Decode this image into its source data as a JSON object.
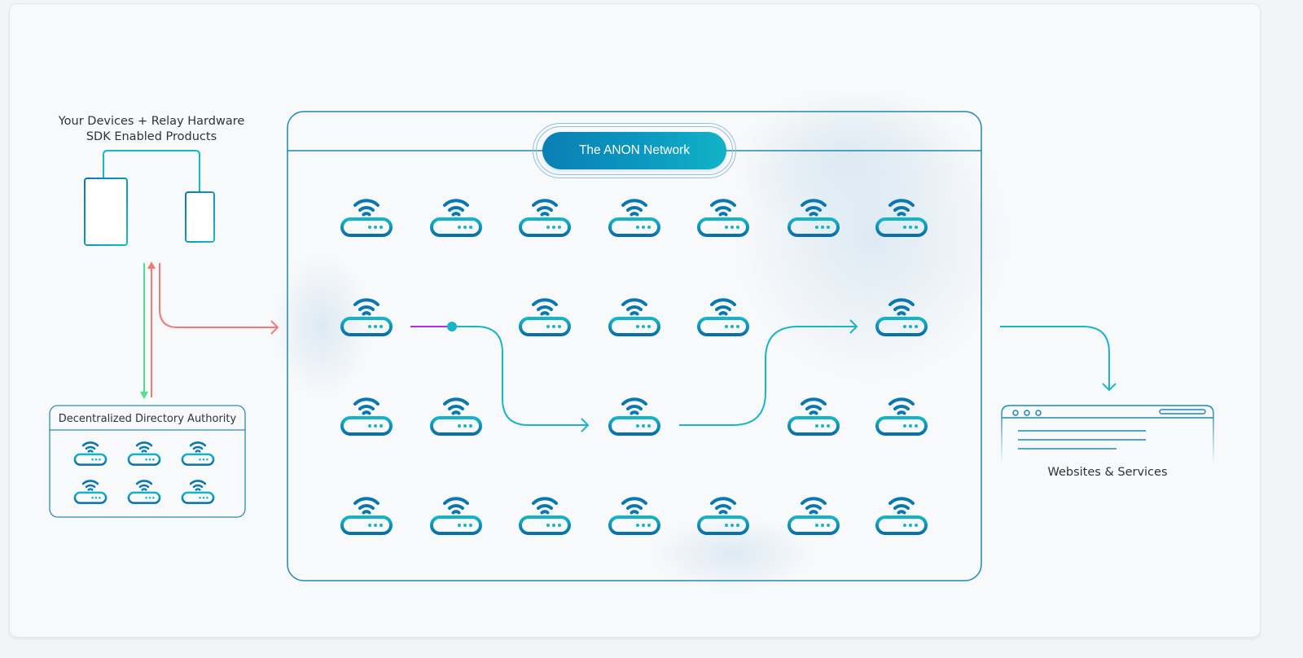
{
  "devices": {
    "title_line1": "Your Devices + Relay Hardware",
    "title_line2": "SDK Enabled Products",
    "icon": "devices-icon"
  },
  "directory_authority": {
    "title": "Decentralized Directory Authority",
    "relay_rows": 2,
    "relay_cols": 3
  },
  "network": {
    "title": "The ANON Network",
    "relay_grid": [
      [
        true,
        true,
        true,
        true,
        true,
        true,
        true
      ],
      [
        true,
        false,
        true,
        true,
        true,
        false,
        true
      ],
      [
        true,
        true,
        false,
        true,
        false,
        true,
        true
      ],
      [
        true,
        true,
        true,
        true,
        true,
        true,
        true
      ]
    ]
  },
  "destination": {
    "title": "Websites & Services",
    "icon": "browser-window-icon"
  },
  "connections": [
    {
      "from": "devices",
      "to": "directory-authority",
      "color": "#4ee38a",
      "direction": "down"
    },
    {
      "from": "directory-authority",
      "to": "devices",
      "color": "#f47a78",
      "direction": "up"
    },
    {
      "from": "devices",
      "to": "network",
      "color": "#f47a78",
      "direction": "right"
    },
    {
      "from": "network-entry-relay",
      "to": "network-middle-relay",
      "color": "#1bb5c7",
      "accent": "#b02ee6"
    },
    {
      "from": "network-middle-relay",
      "to": "network-exit-relay",
      "color": "#1bb5c7"
    },
    {
      "from": "network",
      "to": "websites",
      "color": "#1bb5c7"
    }
  ],
  "colors": {
    "relay_dark": "#0a7ab0",
    "relay_light": "#13b6c8",
    "frame": "#1f88b8",
    "pill_start": "#0a7fb4",
    "pill_end": "#12b3c6",
    "text": "#2e3338"
  }
}
